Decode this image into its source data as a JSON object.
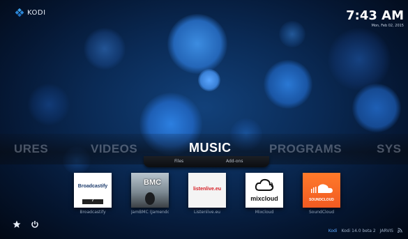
{
  "app": {
    "logo_text": "KODI"
  },
  "clock": {
    "time": "7:43 AM",
    "date": "Mon, Feb 02, 2015"
  },
  "main_menu": {
    "items": [
      {
        "label": "URES",
        "active": false
      },
      {
        "label": "VIDEOS",
        "active": false
      },
      {
        "label": "MUSIC",
        "active": true
      },
      {
        "label": "PROGRAMS",
        "active": false
      },
      {
        "label": "SYS",
        "active": false
      }
    ],
    "submenu": [
      "Files",
      "Add-ons"
    ]
  },
  "addons": [
    {
      "name": "Broadcastify",
      "thumb_text": "Broadcastify",
      "thumb_sub": "7"
    },
    {
      "name": "JamBMC (Jamendo)",
      "thumb_text": "BMC",
      "thumb_sub": ""
    },
    {
      "name": "Listenlive.eu",
      "thumb_text": "listenlive.eu",
      "thumb_sub": ""
    },
    {
      "name": "Mixcloud",
      "thumb_text": "mixcloud",
      "thumb_sub": ""
    },
    {
      "name": "SoundCloud",
      "thumb_text": "SOUNDCLOUD",
      "thumb_sub": ""
    }
  ],
  "footer": {
    "status_prefix": "Kodi",
    "version_text": "Kodi 14.0 beta 2",
    "extra_text": "JARVIS"
  },
  "icons": [
    "kodi-logo-icon",
    "favourites-star-icon",
    "power-icon",
    "rss-icon"
  ],
  "colors": {
    "active_menu": "#ffffff",
    "inactive_menu": "#c8d2e1",
    "accent": "#5aa7ff",
    "soundcloud": "#f15a22",
    "listenlive": "#d61f26"
  }
}
